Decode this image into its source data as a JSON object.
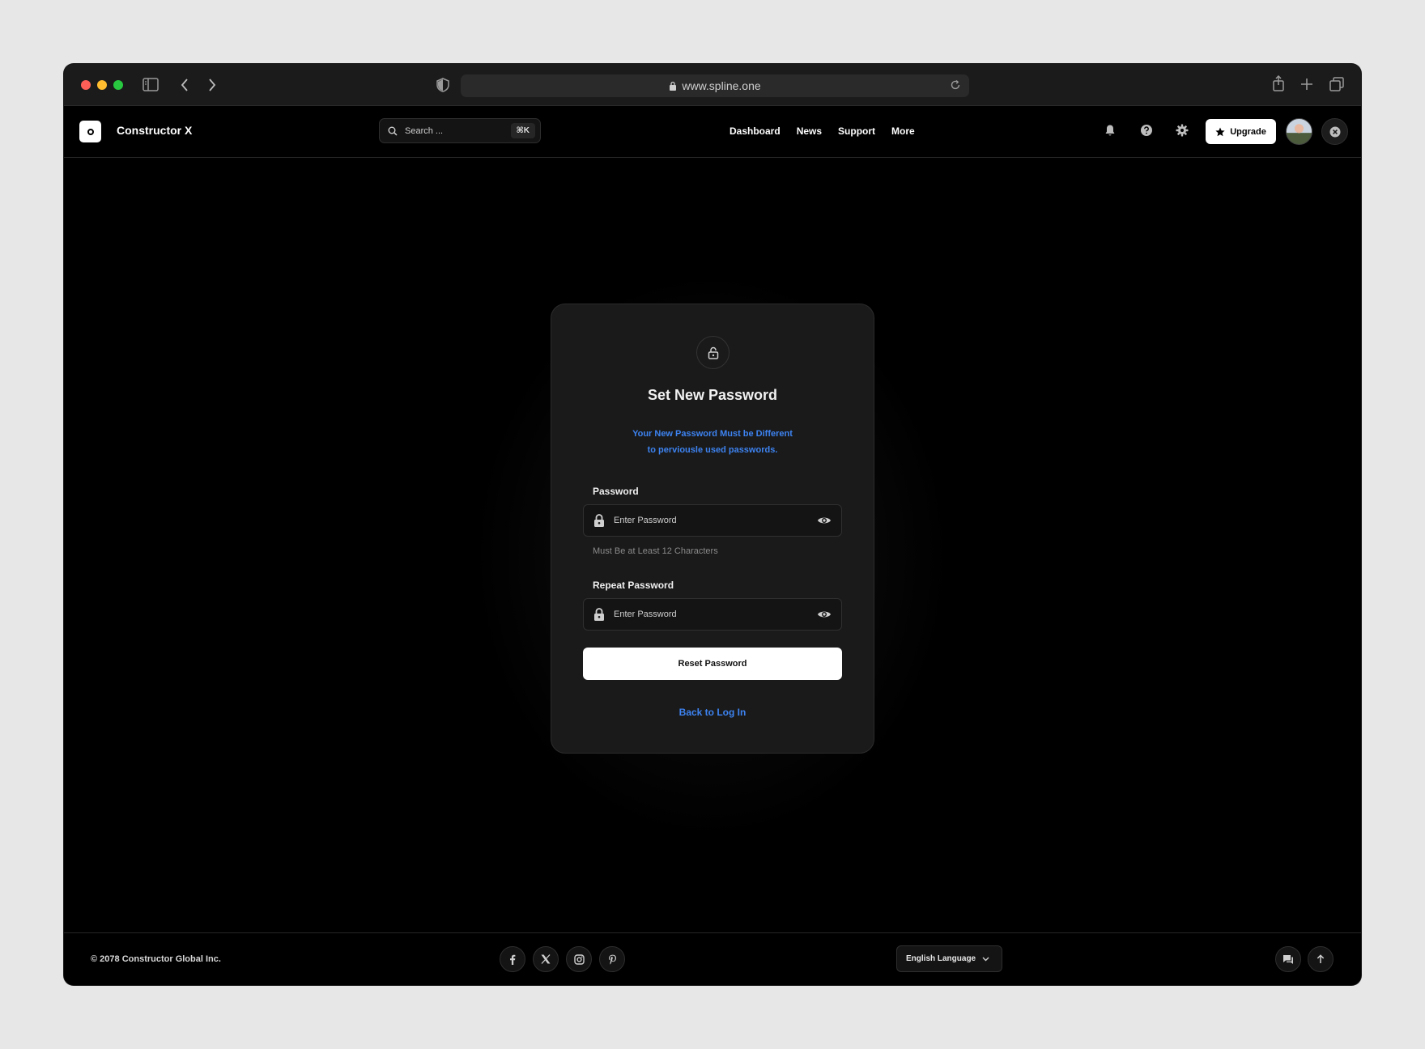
{
  "browser": {
    "url": "www.spline.one",
    "traffic_colors": [
      "#ff5f57",
      "#febc2e",
      "#28c840"
    ]
  },
  "header": {
    "brand": "Constructor X",
    "search_placeholder": "Search ...",
    "search_shortcut": "⌘K",
    "nav": [
      "Dashboard",
      "News",
      "Support",
      "More"
    ],
    "upgrade_label": "Upgrade"
  },
  "card": {
    "title": "Set New Password",
    "subtitle_line1": "Your New Password Must be Different",
    "subtitle_line2": "to perviousle used passwords.",
    "password_label": "Password",
    "password_placeholder": "Enter Password",
    "password_hint": "Must Be at Least 12 Characters",
    "repeat_label": "Repeat Password",
    "repeat_placeholder": "Enter Password",
    "reset_button": "Reset Password",
    "back_link": "Back to Log In",
    "accent_color": "#3d83f1"
  },
  "footer": {
    "copyright": "© 2078 Constructor Global Inc.",
    "language": "English Language",
    "socials": [
      "facebook-icon",
      "x-icon",
      "instagram-icon",
      "pinterest-icon"
    ]
  }
}
